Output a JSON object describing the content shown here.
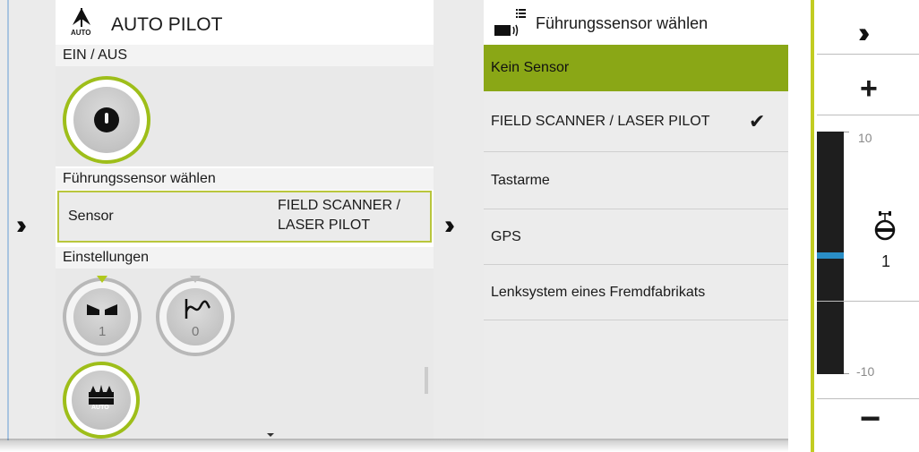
{
  "left_strip": {
    "expand_icon": "double-chevron-right-icon"
  },
  "auto_pilot": {
    "title": "AUTO PILOT",
    "title_icon_label": "AUTO",
    "on_off_header": "EIN / AUS",
    "sensor_header": "Führungssensor wählen",
    "sensor_label": "Sensor",
    "sensor_value_line1": "FIELD SCANNER /",
    "sensor_value_line2": "LASER PILOT",
    "settings_header": "Einstellungen",
    "knob1_value": "1",
    "knob2_value": "0",
    "auto_button_label": "AUTO"
  },
  "sensor_select": {
    "title": "Führungssensor wählen",
    "options": [
      {
        "label": "Kein Sensor",
        "selected": true,
        "checked": false
      },
      {
        "label": "FIELD SCANNER / LASER PILOT",
        "selected": false,
        "checked": true
      },
      {
        "label": "Tastarme",
        "selected": false,
        "checked": false
      },
      {
        "label": "GPS",
        "selected": false,
        "checked": false
      },
      {
        "label": "Lenksystem eines Fremdfabrikats",
        "selected": false,
        "checked": false
      }
    ]
  },
  "scale_panel": {
    "top_tick": "10",
    "bottom_tick": "-10",
    "current_value": "1",
    "plus_label": "+",
    "minus_label": "−"
  },
  "colors": {
    "accent_green": "#8aa716",
    "ring_green": "#9ebe1a",
    "marker_blue": "#2a8ec6"
  }
}
